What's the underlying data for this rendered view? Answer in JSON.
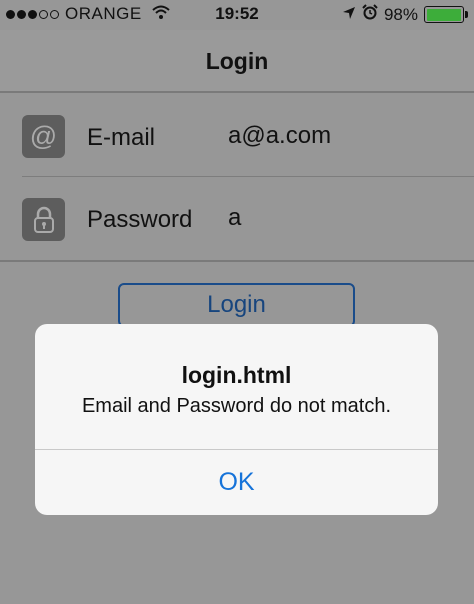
{
  "status_bar": {
    "carrier": "ORANGE",
    "time": "19:52",
    "battery": "98%",
    "battery_level": 0.98,
    "battery_color": "#3dad3a"
  },
  "nav": {
    "title": "Login"
  },
  "form": {
    "email": {
      "label": "E-mail",
      "value": "a@a.com",
      "icon": "at-sign-icon"
    },
    "password": {
      "label": "Password",
      "value": "a",
      "icon": "padlock-icon"
    },
    "login_label": "Login"
  },
  "alert": {
    "title": "login.html",
    "message": "Email and Password do not match.",
    "ok_label": "OK",
    "ok_color": "#1673d9"
  }
}
